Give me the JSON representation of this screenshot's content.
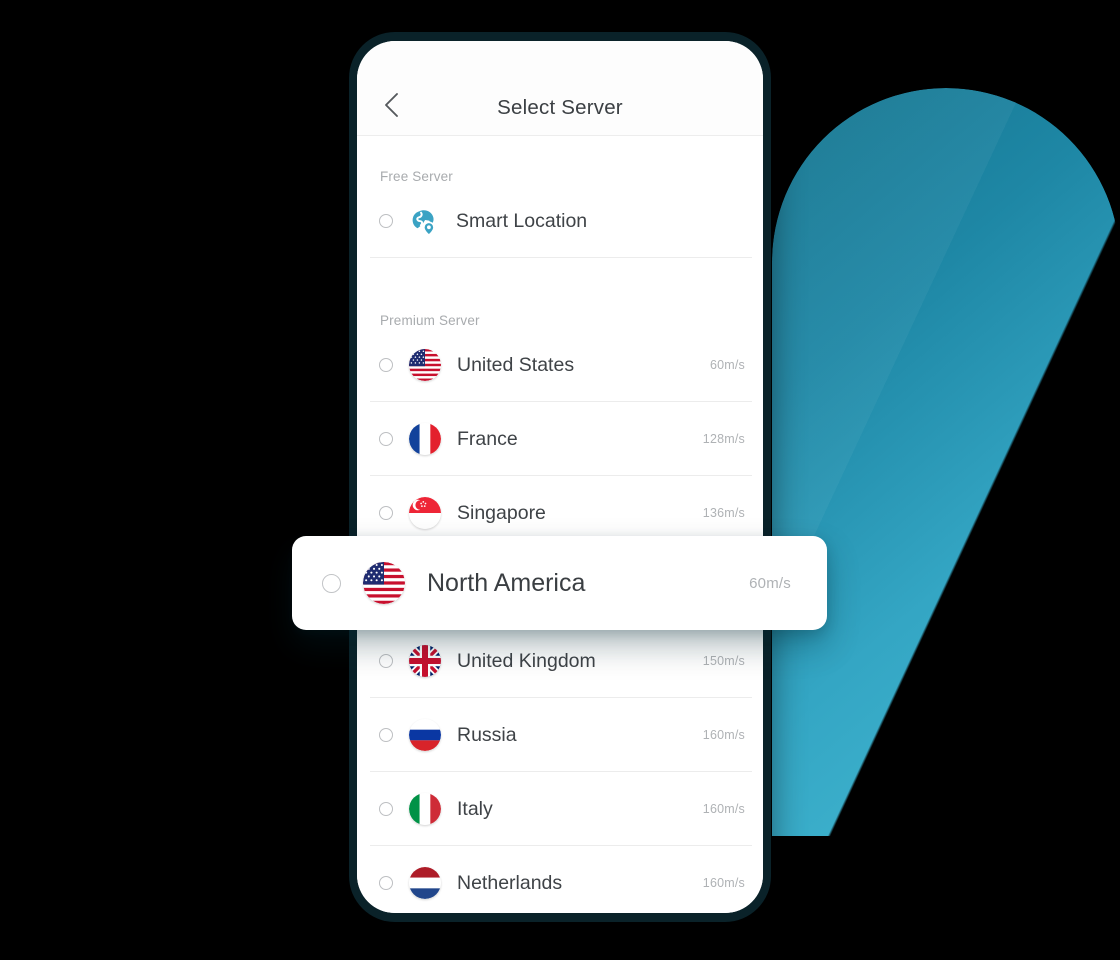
{
  "app": {
    "title": "Select Server",
    "back_icon": "chevron-left-icon"
  },
  "sections": [
    {
      "label": "Free Server"
    },
    {
      "label": "Premium Server"
    }
  ],
  "free_servers": [
    {
      "name": "Smart Location",
      "icon": "smart-location-icon",
      "speed": ""
    }
  ],
  "premium_servers": [
    {
      "name": "United States",
      "flag": "flag-us",
      "speed": "60m/s"
    },
    {
      "name": "France",
      "flag": "flag-fr",
      "speed": "128m/s"
    },
    {
      "name": "Singapore",
      "flag": "flag-sg",
      "speed": "136m/s"
    },
    {
      "name": "United Kingdom",
      "flag": "flag-gb",
      "speed": "150m/s"
    },
    {
      "name": "Russia",
      "flag": "flag-ru",
      "speed": "160m/s"
    },
    {
      "name": "Italy",
      "flag": "flag-it",
      "speed": "160m/s"
    },
    {
      "name": "Netherlands",
      "flag": "flag-nl",
      "speed": "160m/s"
    }
  ],
  "highlight_card": {
    "name": "North America",
    "flag": "flag-us",
    "speed": "60m/s",
    "selected": false
  },
  "colors": {
    "accent_teal_dark": "#14748F",
    "accent_teal_light": "#45BBD4",
    "device_frame": "#0A2229",
    "smart_icon": "#3BA3C4",
    "text_primary": "#3F4347",
    "text_muted": "#AFB2B5",
    "background": "#000000"
  }
}
